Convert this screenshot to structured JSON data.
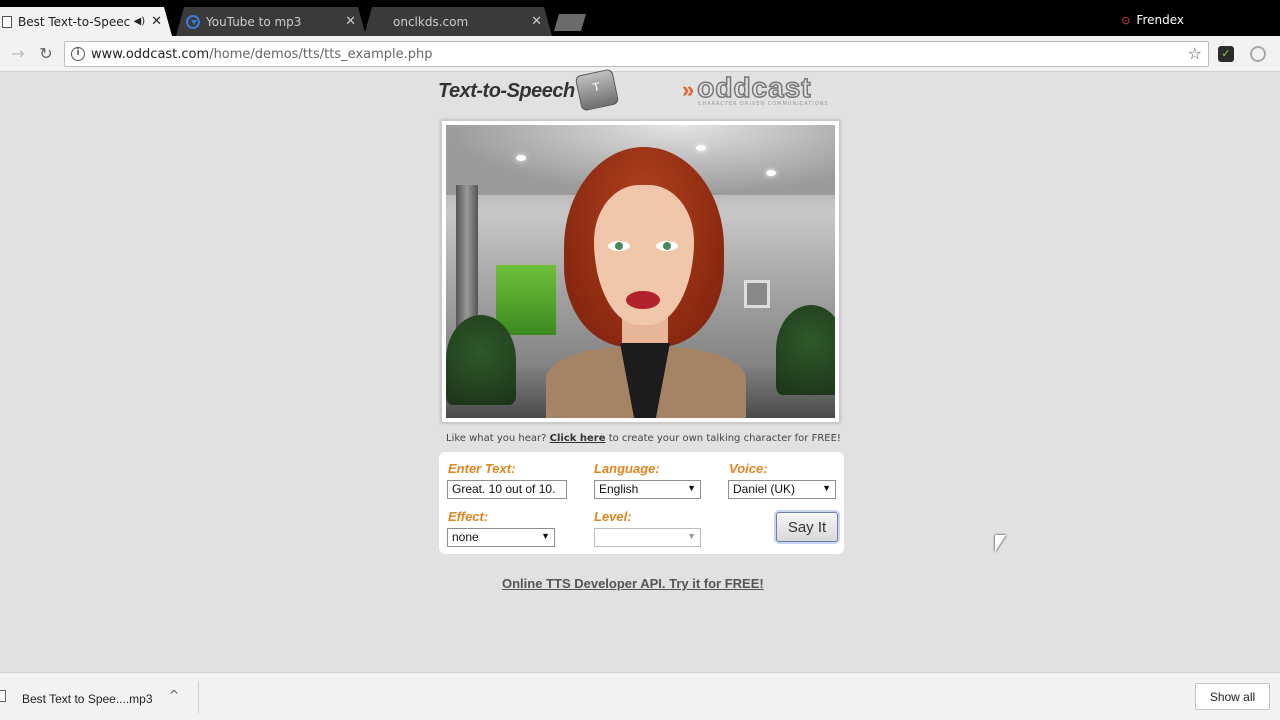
{
  "browser": {
    "tabs": [
      {
        "title": "Best Text-to-Speech D",
        "close": "✕",
        "audio": "◀)"
      },
      {
        "title": "YouTube to mp3",
        "close": "✕"
      },
      {
        "title": "onclkds.com",
        "close": "✕"
      }
    ],
    "profile": "Frendex",
    "url_host": "www.oddcast.com",
    "url_path": "/home/demos/tts/tts_example.php",
    "nav": {
      "back": "←",
      "forward": "→",
      "reload": "↻",
      "star": "☆",
      "info": "i"
    }
  },
  "page": {
    "brand_tts": "Text-to-Speech",
    "keycap_letter": "T",
    "brand_oddcast": "oddcast",
    "brand_arrows": "»",
    "brand_tagline": "CHARACTER DRIVEN COMMUNICATIONS",
    "tagline_pre": "Like what you hear?",
    "tagline_link": "Click here",
    "tagline_post": "to create your own talking character for FREE!",
    "form": {
      "text_label": "Enter Text:",
      "text_value": "Great. 10 out of 10.",
      "language_label": "Language:",
      "language_value": "English",
      "voice_label": "Voice:",
      "voice_value": "Daniel (UK)",
      "effect_label": "Effect:",
      "effect_value": "none",
      "level_label": "Level:",
      "level_value": "",
      "say_button": "Say It",
      "caret": "▼"
    },
    "api_link": "Online TTS Developer API. Try it for FREE!"
  },
  "downloads": {
    "item_name": "Best Text to Spee....mp3",
    "caret": "^",
    "show_all": "Show all"
  }
}
